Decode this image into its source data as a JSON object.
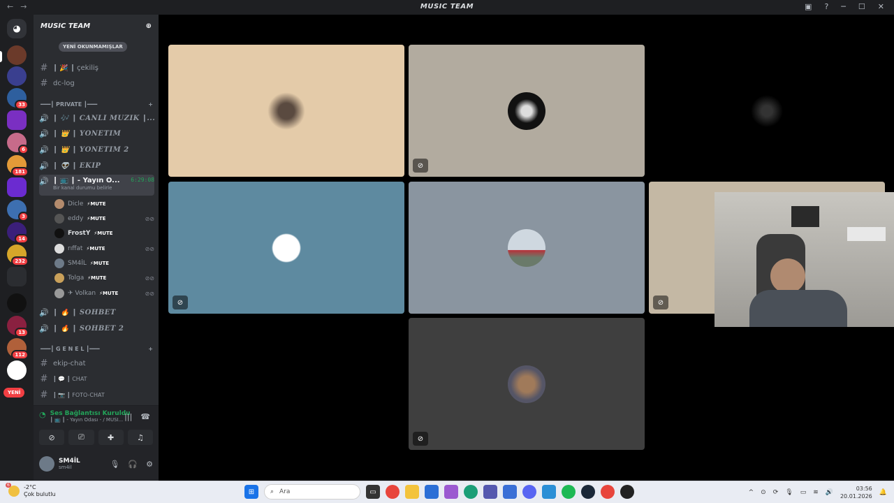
{
  "window": {
    "title": "MUSIC TEAM",
    "back": "←",
    "forward": "→"
  },
  "servers": {
    "badges": [
      "33",
      "6",
      "181",
      "3",
      "14",
      "232",
      "13",
      "112"
    ],
    "new_label": "YENİ"
  },
  "server": {
    "name": "MUSIC TEAM"
  },
  "unread": {
    "label": "YENİ OKUNMAMIŞLAR"
  },
  "channels": {
    "top": [
      {
        "name": "┃ 🎉 ┃ çekiliş"
      },
      {
        "name": "dc-log"
      }
    ],
    "private_category": "━━━┃ PRIVATE ┃━━━",
    "private_voice": [
      {
        "name": "┃ 🎶 ┃ CANLI MUZIK ┃..."
      },
      {
        "name": "┃ 👑 ┃ YÖNETİM"
      },
      {
        "name": "┃ 👑 ┃ YÖNETİM 2"
      },
      {
        "name": "┃ 👽 ┃ EKİP"
      }
    ],
    "active_voice": {
      "name": "┃ 📺 ┃ ‑ Yayın O...",
      "timer": "6:29:08",
      "status": "Bir kanal durumu belirle"
    },
    "members": [
      {
        "name": "Dicle",
        "tag": "⚡MUTE"
      },
      {
        "name": "eddy",
        "tag": "⚡MUTE"
      },
      {
        "name": "FrostY",
        "tag": "⚡MUTE"
      },
      {
        "name": "rıffat",
        "tag": "⚡MUTE"
      },
      {
        "name": "SM4İL",
        "tag": "⚡MUTE"
      },
      {
        "name": "Tolga",
        "tag": "⚡MUTE"
      },
      {
        "name": "✈ Volkan",
        "tag": "⚡MUTE"
      }
    ],
    "after_voice": [
      {
        "name": "┃ 🔥 ┃ SOHBET"
      },
      {
        "name": "┃ 🔥 ┃ SOHBET 2"
      }
    ],
    "genel_category": "━━━┃ G E N E L ┃━━━",
    "genel": [
      {
        "name": "ekip-chat"
      },
      {
        "name": "┃ 💬 ┃ CHAT"
      },
      {
        "name": "┃ 📷 ┃ FOTO-CHAT"
      }
    ]
  },
  "voice_panel": {
    "status": "Ses Bağlantısı Kuruldu",
    "channel": "┃ 📺 ┃ ‑ Yayın Odası ‑ / MUSI..."
  },
  "user": {
    "name": "SM4İL",
    "sub": "sm4il"
  },
  "taskbar": {
    "temp": "-2°C",
    "weather": "Çok bulutlu",
    "weather_badge": "6",
    "search": "Ara",
    "time": "03:56",
    "date": "20.01.2026"
  },
  "colors": {
    "accent_green": "#23a55a",
    "badge_red": "#f23f43"
  }
}
